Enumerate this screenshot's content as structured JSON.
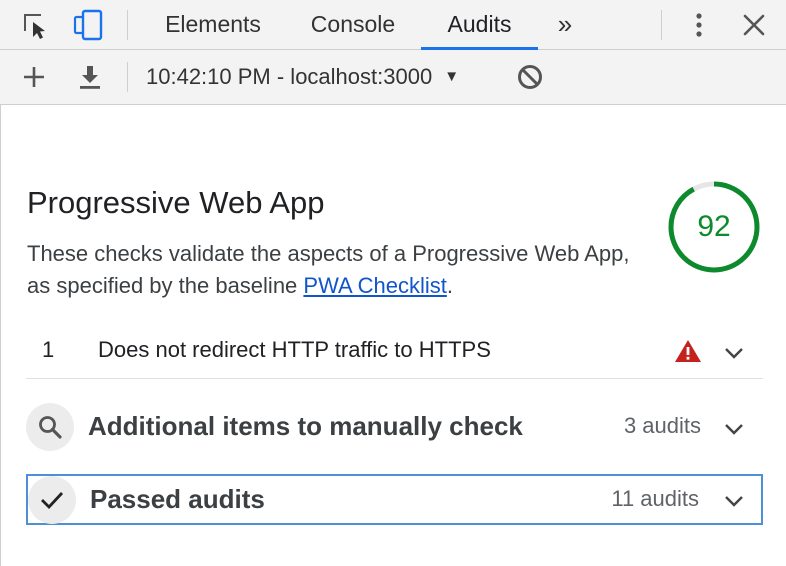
{
  "tabs": {
    "items": [
      "Elements",
      "Console",
      "Audits"
    ],
    "active": "Audits",
    "overflow": "»"
  },
  "toolbar": {
    "report_selector": "10:42:10 PM - localhost:3000"
  },
  "category": {
    "title": "Progressive Web App",
    "description_prefix": "These checks validate the aspects of a Progressive Web App, as specified by the baseline ",
    "link_text": "PWA Checklist",
    "description_suffix": ".",
    "score": "92",
    "score_fraction": 0.92,
    "score_color": "#0d8a2c"
  },
  "failed_audit": {
    "index": "1",
    "title": "Does not redirect HTTP traffic to HTTPS",
    "warning_color": "#c5221f"
  },
  "groups": {
    "manual": {
      "title": "Additional items to manually check",
      "count": "3 audits"
    },
    "passed": {
      "title": "Passed audits",
      "count": "11 audits"
    }
  },
  "colors": {
    "accent": "#1a73e8",
    "link": "#1155cc"
  }
}
